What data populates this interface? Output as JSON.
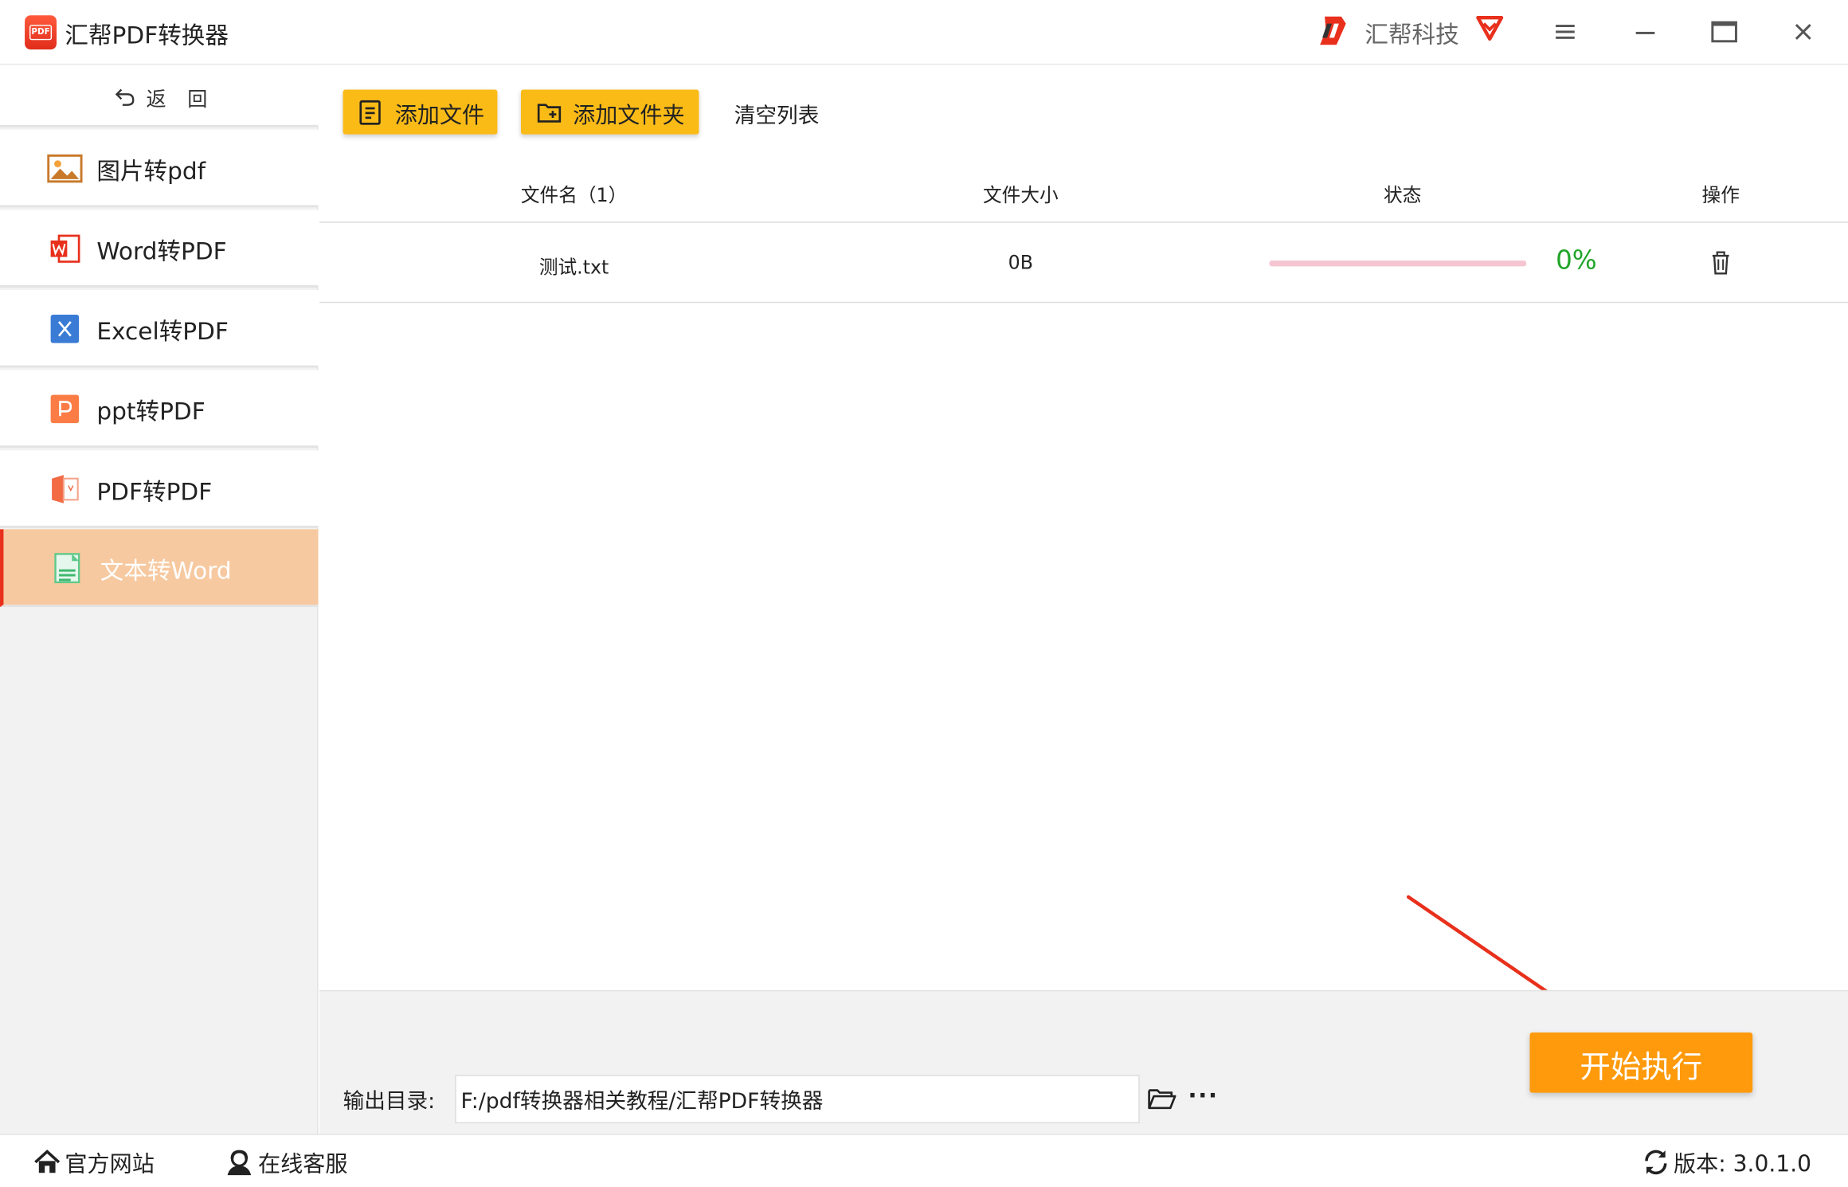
{
  "app": {
    "title": "汇帮PDF转换器",
    "brand_name": "汇帮科技",
    "logo_text": "PDF"
  },
  "sidebar": {
    "back_label": "返回",
    "items": [
      {
        "label": "图片转pdf",
        "icon": "image-icon"
      },
      {
        "label": "Word转PDF",
        "icon": "word-icon"
      },
      {
        "label": "Excel转PDF",
        "icon": "excel-icon"
      },
      {
        "label": "ppt转PDF",
        "icon": "ppt-icon"
      },
      {
        "label": "PDF转PDF",
        "icon": "pdf-icon"
      },
      {
        "label": "文本转Word",
        "icon": "text-doc-icon",
        "active": true
      }
    ]
  },
  "toolbar": {
    "add_file_label": "添加文件",
    "add_folder_label": "添加文件夹",
    "clear_label": "清空列表"
  },
  "table": {
    "headers": {
      "name": "文件名（1）",
      "size": "文件大小",
      "status": "状态",
      "action": "操作"
    },
    "rows": [
      {
        "name": "测试.txt",
        "size": "0B",
        "progress": 0,
        "status": "0%"
      }
    ]
  },
  "output": {
    "label": "输出目录:",
    "path": "F:/pdf转换器相关教程/汇帮PDF转换器",
    "more_label": "···"
  },
  "start_label": "开始执行",
  "statusbar": {
    "website_label": "官方网站",
    "service_label": "在线客服",
    "version_label": "版本: 3.0.1.0"
  },
  "colors": {
    "accent_yellow": "#fbbb17",
    "start_orange": "#fe9a0b",
    "active_nav": "#f7c9a0",
    "progress_green": "#21a52a",
    "annotation_red": "#e8301c"
  }
}
